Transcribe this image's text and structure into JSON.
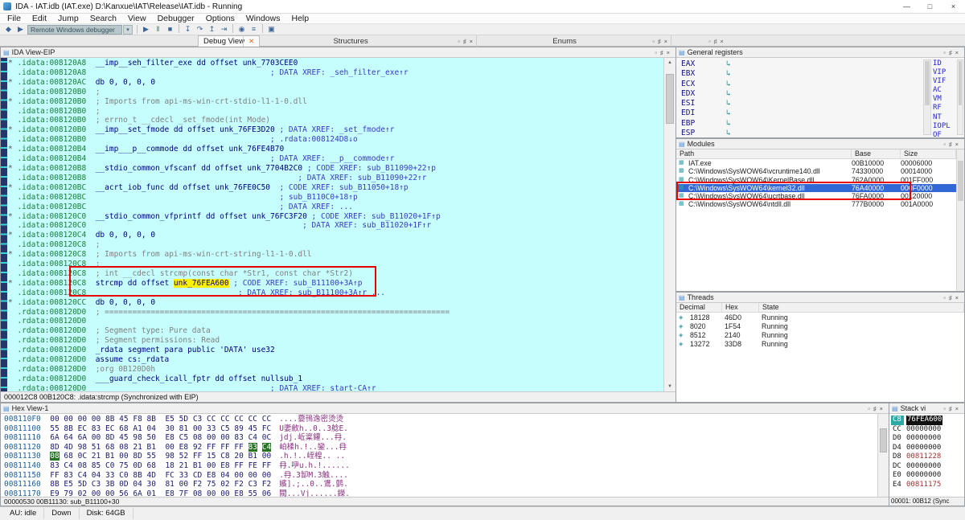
{
  "colors": {
    "disasm_bg": "#C6FDFD",
    "highlight_yellow": "#FFF200",
    "annotation_red": "#E80000",
    "selection_blue": "#3168D5",
    "hex_selection_green": "#267326",
    "esp_marker_teal": "#2FA8A8"
  },
  "window": {
    "title": "IDA - IAT.idb (IAT.exe) D:\\Kanxue\\IAT\\Release\\IAT.idb - Running"
  },
  "chrome": {
    "panel_icon": "▤",
    "module_icon": "▦",
    "thread_icon": "◈",
    "dock_controls": [
      "▫",
      "♯",
      "×"
    ],
    "dock_control_names": [
      "dock-float-icon",
      "dock-pin-icon",
      "dock-close-icon"
    ],
    "window_controls": [
      {
        "name": "minimize-icon",
        "g": "—"
      },
      {
        "name": "maximize-icon",
        "g": "□"
      },
      {
        "name": "close-icon",
        "g": "×"
      }
    ],
    "scroll_up": "▲",
    "scroll_down": "▼"
  },
  "menu": {
    "items": [
      "File",
      "Edit",
      "Jump",
      "Search",
      "View",
      "Debugger",
      "Options",
      "Windows",
      "Help"
    ]
  },
  "toolbar": {
    "debugger_combo": "Remote Windows debugger",
    "combo_arrow": "▾",
    "pre_buttons": [
      {
        "name": "debugger-indicator-icon",
        "glyph": "◆"
      },
      {
        "name": "continue-process-icon",
        "glyph": "▶"
      }
    ],
    "buttons": [
      {
        "name": "start-process-icon",
        "glyph": "▶"
      },
      {
        "name": "pause-process-icon",
        "glyph": "‖"
      },
      {
        "name": "stop-process-icon",
        "glyph": "■"
      },
      {
        "sep": true
      },
      {
        "name": "step-into-icon",
        "glyph": "↧"
      },
      {
        "name": "step-over-icon",
        "glyph": "↷"
      },
      {
        "name": "step-out-icon",
        "glyph": "↥"
      },
      {
        "name": "run-to-cursor-icon",
        "glyph": "⇥"
      },
      {
        "sep": true
      },
      {
        "name": "breakpoint-icon",
        "glyph": "◉"
      },
      {
        "name": "breakpoint-list-icon",
        "glyph": "≡"
      },
      {
        "sep": true
      },
      {
        "name": "debugger-windows-icon",
        "glyph": "▣"
      }
    ]
  },
  "tabs": {
    "debug_view": "Debug View",
    "close_glyph": "✕",
    "structures": "Structures",
    "enums": "Enums"
  },
  "disasm": {
    "title": "IDA View-EIP",
    "status": "000012C8 00B120C8: .idata:strcmp (Synchronized with EIP)",
    "lines": [
      {
        "s": 1,
        "p": [
          [
            ".idata:008120A8",
            "a"
          ],
          [
            "  __imp__seh_filter_exe dd offset unk_7703CEE0",
            "n"
          ]
        ]
      },
      {
        "s": 0,
        "p": [
          [
            ".idata:008120A8",
            "a"
          ],
          [
            "                                        ; DATA XREF: _seh_filter_exe↑r",
            "c"
          ]
        ]
      },
      {
        "s": 1,
        "p": [
          [
            ".idata:008120AC",
            "a"
          ],
          [
            "  db 0, 0, 0, 0",
            "n"
          ]
        ]
      },
      {
        "s": 0,
        "p": [
          [
            ".idata:008120B0",
            "a"
          ],
          [
            "  ;",
            "g"
          ]
        ]
      },
      {
        "s": 1,
        "p": [
          [
            ".idata:008120B0",
            "a"
          ],
          [
            "  ; Imports from api-ms-win-crt-stdio-l1-1-0.dll",
            "g"
          ]
        ]
      },
      {
        "s": 0,
        "p": [
          [
            ".idata:008120B0",
            "a"
          ],
          [
            "  ;",
            "g"
          ]
        ]
      },
      {
        "s": 0,
        "p": [
          [
            ".idata:008120B0",
            "a"
          ],
          [
            "  ; errno_t __cdecl _set_fmode(int Mode)",
            "g"
          ]
        ]
      },
      {
        "s": 1,
        "p": [
          [
            ".idata:008120B0",
            "a"
          ],
          [
            "  __imp__set_fmode dd offset unk_76FE3D20",
            "n"
          ],
          [
            " ",
            "n"
          ],
          [
            "; DATA XREF: _set_fmode↑r",
            "c"
          ]
        ]
      },
      {
        "s": 0,
        "p": [
          [
            ".idata:008120B0",
            "a"
          ],
          [
            "                                        ; .rdata:008124D8↓o",
            "c"
          ]
        ]
      },
      {
        "s": 1,
        "p": [
          [
            ".idata:008120B4",
            "a"
          ],
          [
            "  __imp___p__commode dd offset unk_76FE4B70",
            "n"
          ]
        ]
      },
      {
        "s": 0,
        "p": [
          [
            ".idata:008120B4",
            "a"
          ],
          [
            "                                        ; DATA XREF: __p__commode↑r",
            "c"
          ]
        ]
      },
      {
        "s": 1,
        "p": [
          [
            ".idata:008120B8",
            "a"
          ],
          [
            "  __stdio_common_vfscanf dd offset unk_7704B2C0",
            "n"
          ],
          [
            " ",
            "n"
          ],
          [
            "; CODE XREF: sub_B11090+22↑p",
            "c"
          ]
        ]
      },
      {
        "s": 0,
        "p": [
          [
            ".idata:008120B8",
            "a"
          ],
          [
            "                                              ; DATA XREF: sub_B11090+22↑r",
            "c"
          ]
        ]
      },
      {
        "s": 1,
        "p": [
          [
            ".idata:008120BC",
            "a"
          ],
          [
            "  __acrt_iob_func dd offset unk_76FE0C50",
            "n"
          ],
          [
            "  ",
            "n"
          ],
          [
            "; CODE XREF: sub_B11050+18↑p",
            "c"
          ]
        ]
      },
      {
        "s": 0,
        "p": [
          [
            ".idata:008120BC",
            "a"
          ],
          [
            "                                          ; sub_B110C0+18↑p",
            "c"
          ]
        ]
      },
      {
        "s": 0,
        "p": [
          [
            ".idata:008120BC",
            "a"
          ],
          [
            "                                          ; DATA XREF: ...",
            "c"
          ]
        ]
      },
      {
        "s": 1,
        "p": [
          [
            ".idata:008120C0",
            "a"
          ],
          [
            "  __stdio_common_vfprintf dd offset unk_76FC3F20",
            "n"
          ],
          [
            " ",
            "n"
          ],
          [
            "; CODE XREF: sub_B11020+1F↑p",
            "c"
          ]
        ]
      },
      {
        "s": 0,
        "p": [
          [
            ".idata:008120C0",
            "a"
          ],
          [
            "                                               ; DATA XREF: sub_B11020+1F↑r",
            "c"
          ]
        ]
      },
      {
        "s": 1,
        "p": [
          [
            ".idata:008120C4",
            "a"
          ],
          [
            "  db 0, 0, 0, 0",
            "n"
          ]
        ]
      },
      {
        "s": 0,
        "p": [
          [
            ".idata:008120C8",
            "a"
          ],
          [
            "  ;",
            "g"
          ]
        ]
      },
      {
        "s": 1,
        "p": [
          [
            ".idata:008120C8",
            "a"
          ],
          [
            "  ; Imports from api-ms-win-crt-string-l1-1-0.dll",
            "g"
          ]
        ]
      },
      {
        "s": 0,
        "p": [
          [
            ".idata:008120C8",
            "a"
          ],
          [
            "  ;",
            "g"
          ]
        ]
      },
      {
        "s": 0,
        "p": [
          [
            ".idata:008120C8",
            "a"
          ],
          [
            "  ; int __cdecl strcmp(const char *Str1, const char *Str2)",
            "g"
          ]
        ]
      },
      {
        "s": 1,
        "p": [
          [
            ".idata:008120C8",
            "a"
          ],
          [
            "  strcmp dd offset ",
            "n"
          ],
          [
            "unk_76FEA600",
            "y"
          ],
          [
            " ",
            "n"
          ],
          [
            "; CODE XREF: sub_B11100+3A↑p",
            "c"
          ]
        ]
      },
      {
        "s": 0,
        "p": [
          [
            ".idata:008120C8",
            "a"
          ],
          [
            "                                 ; DATA XREF: sub_B11100+3A↑r ...",
            "c"
          ]
        ]
      },
      {
        "s": 1,
        "p": [
          [
            ".idata:008120CC",
            "a"
          ],
          [
            "  db 0, 0, 0, 0",
            "n"
          ]
        ]
      },
      {
        "s": 0,
        "p": [
          [
            ".rdata:008120D0",
            "a"
          ],
          [
            "  ; ===========================================================================",
            "g"
          ]
        ]
      },
      {
        "s": 0,
        "p": [
          [
            ".rdata:008120D0",
            "a"
          ]
        ]
      },
      {
        "s": 0,
        "p": [
          [
            ".rdata:008120D0",
            "a"
          ],
          [
            "  ; Segment type: Pure data",
            "g"
          ]
        ]
      },
      {
        "s": 0,
        "p": [
          [
            ".rdata:008120D0",
            "a"
          ],
          [
            "  ; Segment permissions: Read",
            "g"
          ]
        ]
      },
      {
        "s": 0,
        "p": [
          [
            ".rdata:008120D0",
            "a"
          ],
          [
            "  _rdata segment para public 'DATA' use32",
            "n"
          ]
        ]
      },
      {
        "s": 0,
        "p": [
          [
            ".rdata:008120D0",
            "a"
          ],
          [
            "  assume cs:_rdata",
            "n"
          ]
        ]
      },
      {
        "s": 0,
        "p": [
          [
            ".rdata:008120D0",
            "a"
          ],
          [
            "  ;org 0B120D0h",
            "g"
          ]
        ]
      },
      {
        "s": 0,
        "p": [
          [
            ".rdata:008120D0",
            "a"
          ],
          [
            "  ___guard_check_icall_fptr dd offset nullsub_1",
            "n"
          ]
        ]
      },
      {
        "s": 0,
        "p": [
          [
            ".rdata:008120D0",
            "a"
          ],
          [
            "                                        ; DATA XREF: start-CA↑r",
            "c"
          ]
        ]
      }
    ]
  },
  "registers": {
    "title": "General registers",
    "arrow": "↳",
    "regs": [
      "EAX",
      "EBX",
      "ECX",
      "EDX",
      "ESI",
      "EDI",
      "EBP",
      "ESP"
    ],
    "flags": [
      "ID",
      "VIP",
      "VIF",
      "AC",
      "VM",
      "RF",
      "NT",
      "IOPL",
      "OF"
    ]
  },
  "modules": {
    "title": "Modules",
    "columns": [
      "Path",
      "Base",
      "Size"
    ],
    "rows": [
      {
        "path": "IAT.exe",
        "base": "00B10000",
        "size": "00006000"
      },
      {
        "path": "C:\\Windows\\SysWOW64\\vcruntime140.dll",
        "base": "74330000",
        "size": "00014000"
      },
      {
        "path": "C:\\Windows\\SysWOW64\\KernelBase.dll",
        "base": "762A0000",
        "size": "001FF000"
      },
      {
        "path": "C:\\Windows\\SysWOW64\\kernel32.dll",
        "base": "76A40000",
        "size": "000F0000",
        "selected": true
      },
      {
        "path": "C:\\Windows\\SysWOW64\\ucrtbase.dll",
        "base": "76FA0000",
        "size": "00120000"
      },
      {
        "path": "C:\\Windows\\SysWOW64\\ntdll.dll",
        "base": "777B0000",
        "size": "001A0000"
      }
    ]
  },
  "threads": {
    "title": "Threads",
    "columns": [
      "Decimal",
      "Hex",
      "State"
    ],
    "rows": [
      [
        "18128",
        "46D0",
        "Running"
      ],
      [
        "8020",
        "1F54",
        "Running"
      ],
      [
        "8512",
        "2140",
        "Running"
      ],
      [
        "13272",
        "33D8",
        "Running"
      ]
    ]
  },
  "hex": {
    "title": "Hex View-1",
    "status": "00000530 00B11130: sub_B11100+30",
    "selection": {
      "3": [
        14,
        15
      ],
      "4": [
        0
      ]
    },
    "rows": [
      {
        "addr": "008110F0",
        "b": [
          "00",
          "00",
          "00",
          "00",
          "8B",
          "45",
          "F8",
          "8B",
          "E5",
          "5D",
          "C3",
          "CC",
          "CC",
          "CC",
          "CC",
          "CC"
        ],
        "ascii": "....嬊鳱逸密烫烫"
      },
      {
        "addr": "00811100",
        "b": [
          "55",
          "8B",
          "EC",
          "83",
          "EC",
          "68",
          "A1",
          "04",
          "30",
          "81",
          "00",
          "33",
          "C5",
          "89",
          "45",
          "FC"
        ],
        "ascii": "U嬱斂h..0..3艌E."
      },
      {
        "addr": "00811110",
        "b": [
          "6A",
          "64",
          "6A",
          "00",
          "8D",
          "45",
          "98",
          "50",
          "E8",
          "C5",
          "08",
          "00",
          "00",
          "83",
          "C4",
          "0C"
        ],
        "ascii": "jdj.岴楶鑵...冄."
      },
      {
        "addr": "00811120",
        "b": [
          "8D",
          "4D",
          "98",
          "51",
          "68",
          "08",
          "21",
          "B1",
          "00",
          "E8",
          "92",
          "FF",
          "FF",
          "FF",
          "83",
          "C4"
        ],
        "ascii": "岶楺h.!..鑾...冄"
      },
      {
        "addr": "00811130",
        "b": [
          "08",
          "68",
          "0C",
          "21",
          "B1",
          "00",
          "8D",
          "55",
          "98",
          "52",
          "FF",
          "15",
          "C8",
          "20",
          "B1",
          "00"
        ],
        "ascii": ".h.!..峌楻.. .."
      },
      {
        "addr": "00811140",
        "b": [
          "83",
          "C4",
          "08",
          "85",
          "C0",
          "75",
          "0D",
          "68",
          "18",
          "21",
          "B1",
          "00",
          "E8",
          "FF",
          "FE",
          "FF"
        ],
        "ascii": "冄.吚u.h.!......"
      },
      {
        "addr": "00811150",
        "b": [
          "FF",
          "83",
          "C4",
          "04",
          "33",
          "C0",
          "8B",
          "4D",
          "FC",
          "33",
          "CD",
          "E8",
          "04",
          "00",
          "00",
          "00"
        ],
        "ascii": ".冄.3缷M.3触...."
      },
      {
        "addr": "00811160",
        "b": [
          "8B",
          "E5",
          "5D",
          "C3",
          "3B",
          "0D",
          "04",
          "30",
          "81",
          "00",
          "F2",
          "75",
          "02",
          "F2",
          "C3",
          "F2"
        ],
        "ascii": "嬪].;..0..鷕.鹯."
      },
      {
        "addr": "00811170",
        "b": [
          "E9",
          "79",
          "02",
          "00",
          "00",
          "56",
          "6A",
          "01",
          "E8",
          "7F",
          "08",
          "00",
          "00",
          "E8",
          "55",
          "06"
        ],
        "ascii": "閥...Vj......鑅."
      }
    ]
  },
  "stack": {
    "title": "Stack vi",
    "status": "00001: 00B12 (Sync",
    "rows": [
      {
        "off": "C8",
        "val": "76FEA600",
        "esp": true,
        "sel": true
      },
      {
        "off": "CC",
        "val": "00000000"
      },
      {
        "off": "D0",
        "val": "00000000"
      },
      {
        "off": "D4",
        "val": "00000000"
      },
      {
        "off": "D8",
        "val": "00811228",
        "red": true
      },
      {
        "off": "DC",
        "val": "00000000"
      },
      {
        "off": "E0",
        "val": "00000000"
      },
      {
        "off": "E4",
        "val": "00811175",
        "red": true
      }
    ]
  },
  "statusbar": {
    "items": [
      "AU: idle",
      "Down",
      "Disk: 64GB"
    ]
  }
}
